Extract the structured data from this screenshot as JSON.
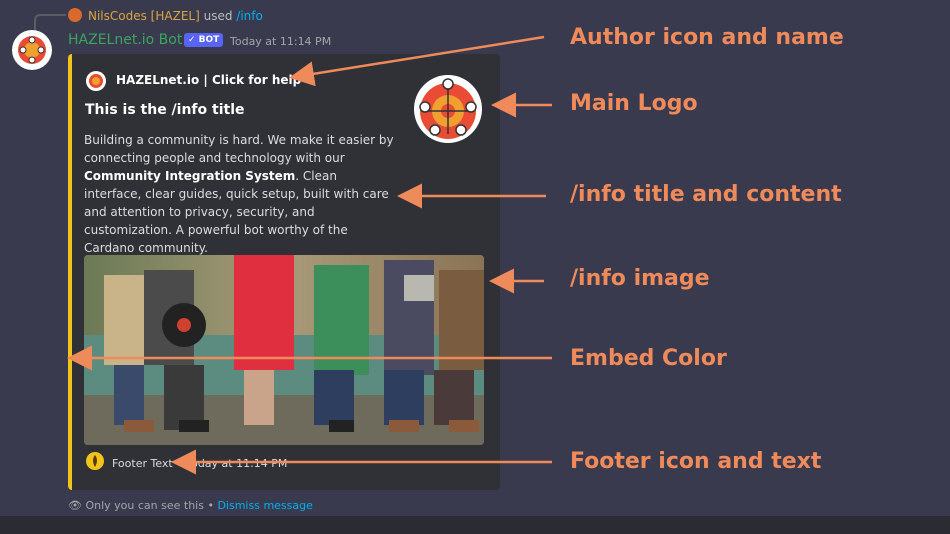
{
  "reply": {
    "user": "NilsCodes [HAZEL]",
    "verb": "used",
    "command": "/info"
  },
  "message": {
    "bot_name": "HAZELnet.io Bot",
    "badge": "✓ BOT",
    "timestamp": "Today at 11:14 PM"
  },
  "embed": {
    "color": "#f0c419",
    "author_name": "HAZELnet.io | Click for help",
    "title": "This is the /info title",
    "desc_1": "Building a community is hard. We make it easier by connecting people and technology with our ",
    "desc_bold": "Community Integration System",
    "desc_2": ". Clean interface, clear guides, quick setup, built with care and attention to privacy, security, and customization. A powerful bot worthy of the Cardano community.",
    "footer_text": "Footer Text",
    "footer_sep": " • ",
    "footer_time": "Today at 11:14 PM"
  },
  "ephemeral": {
    "text": "Only you can see this • ",
    "link": "Dismiss message"
  },
  "callouts": {
    "author": "Author icon and name",
    "logo": "Main Logo",
    "title_content": "/info title and content",
    "image": "/info image",
    "color": "Embed Color",
    "footer": "Footer icon and text"
  },
  "colors": {
    "callout": "#ef8a5b",
    "background": "#3a3a4f",
    "embed_bg": "#2f3136",
    "embed_border": "#f0c419"
  }
}
